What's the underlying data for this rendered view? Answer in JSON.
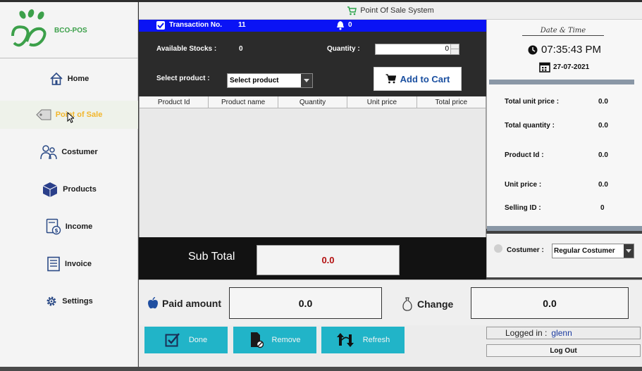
{
  "app": {
    "brand": "BCO-POS",
    "title": "Point Of Sale System"
  },
  "nav": {
    "items": [
      {
        "label": "Home",
        "icon": "home-icon"
      },
      {
        "label": "Point of Sale",
        "icon": "price-tag-icon"
      },
      {
        "label": "Costumer",
        "icon": "customers-icon"
      },
      {
        "label": "Products",
        "icon": "box-icon"
      },
      {
        "label": "Income",
        "icon": "income-icon"
      },
      {
        "label": "Invoice",
        "icon": "invoice-icon"
      },
      {
        "label": "Settings",
        "icon": "gear-icon"
      }
    ],
    "active": "Point of Sale"
  },
  "transaction": {
    "label": "Transaction No.",
    "number": "11",
    "notifications": "0"
  },
  "inputs": {
    "stocks_label": "Available Stocks :",
    "stocks_value": "0",
    "quantity_label": "Quantity :",
    "quantity_value": "0",
    "select_label": "Select product :",
    "select_value": "Select product",
    "add_to_cart": "Add to Cart"
  },
  "table": {
    "columns": [
      "Product Id",
      "Product name",
      "Quantity",
      "Unit price",
      "Total price"
    ],
    "rows": []
  },
  "subtotal": {
    "label": "Sub Total",
    "value": "0.0"
  },
  "datetime": {
    "label": "Date & Time",
    "time": "07:35:43 PM",
    "date": "27-07-2021"
  },
  "details": {
    "total_unit_price_label": "Total unit price :",
    "total_unit_price": "0.0",
    "total_quantity_label": "Total quantity :",
    "total_quantity": "0.0",
    "product_id_label": "Product Id :",
    "product_id": "0.0",
    "unit_price_label": "Unit price :",
    "unit_price": "0.0",
    "selling_id_label": "Selling ID :",
    "selling_id": "0"
  },
  "customer": {
    "label": "Costumer :",
    "value": "Regular Costumer"
  },
  "payment": {
    "paid_label": "Paid amount",
    "paid_value": "0.0",
    "change_label": "Change",
    "change_value": "0.0"
  },
  "actions": {
    "done": "Done",
    "remove": "Remove",
    "refresh": "Refresh"
  },
  "session": {
    "logged_in_label": "Logged in :",
    "user": "glenn",
    "logout": "Log Out"
  },
  "colors": {
    "accent_blue": "#0a13f5",
    "button_teal": "#21b4c8",
    "active_nav": "#f2b62c",
    "subtotal_red": "#b30f0f",
    "brand_green": "#3ca04a"
  }
}
